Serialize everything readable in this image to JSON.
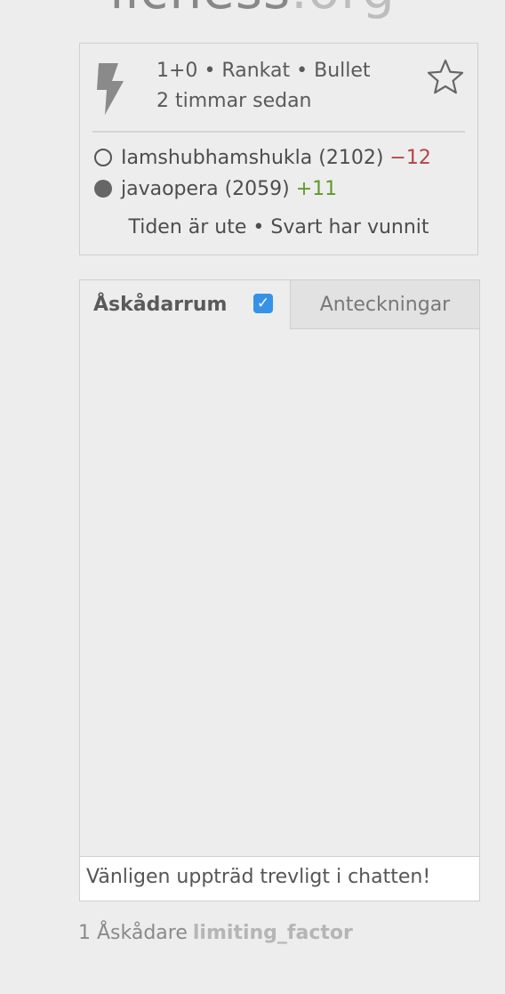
{
  "logo": {
    "name": "lichess",
    "tld": ".org"
  },
  "game": {
    "clock": "1+0",
    "separator": "•",
    "rating_type": "Rankat",
    "speed": "Bullet",
    "time_ago": "2 timmar sedan",
    "players": [
      {
        "color": "white",
        "name": "Iamshubhamshukla",
        "rating": "(2102)",
        "diff": "−12"
      },
      {
        "color": "black",
        "name": "javaopera",
        "rating": "(2059)",
        "diff": "+11"
      }
    ],
    "result": "Tiden är ute • Svart har vunnit"
  },
  "chat": {
    "tab_room": "Åskådarrum",
    "room_enabled": true,
    "tab_notes": "Anteckningar",
    "input_placeholder": "Vänligen uppträd trevligt i chatten!"
  },
  "spectators": {
    "label": "1 Åskådare",
    "users": [
      "limiting_factor"
    ]
  },
  "colors": {
    "accent": "#3692e7",
    "loss": "#b24545",
    "gain": "#5f9a2a"
  },
  "icons": {
    "speed": "lightning-icon",
    "bookmark": "star-icon"
  }
}
